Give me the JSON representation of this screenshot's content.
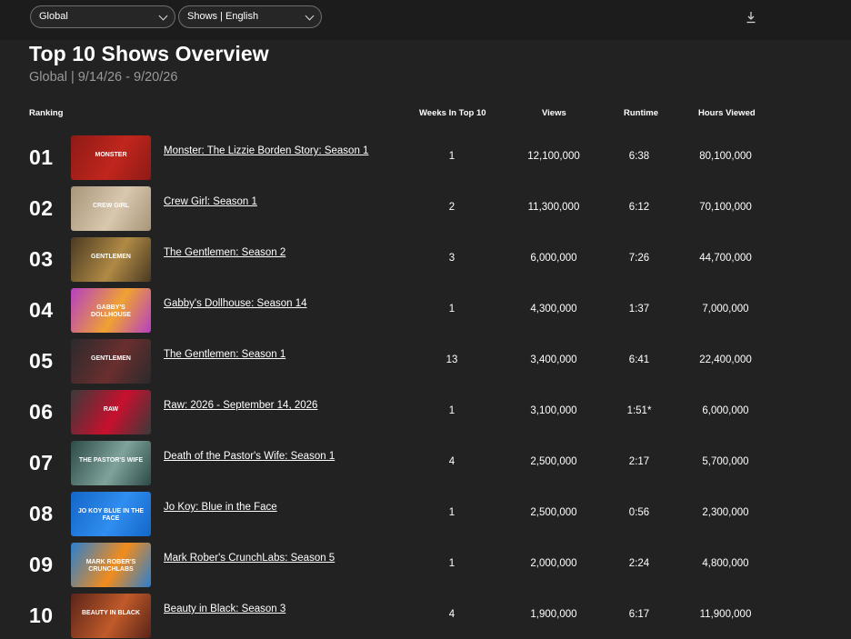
{
  "filters": {
    "region": "Global",
    "category": "Shows | English"
  },
  "header": {
    "title": "Top 10 Shows Overview",
    "subtitle": "Global | 9/14/26 - 9/20/26"
  },
  "columns": {
    "ranking": "Ranking",
    "weeks": "Weeks In Top 10",
    "views": "Views",
    "runtime": "Runtime",
    "hours": "Hours Viewed"
  },
  "rows": [
    {
      "rank": "01",
      "title": "Monster: The Lizzie Borden Story: Season 1",
      "weeks": "1",
      "views": "12,100,000",
      "runtime": "6:38",
      "hours": "80,100,000",
      "thumb_text": "MONSTER",
      "thumb_bg": "#8e1a16",
      "thumb_accent": "#c0261d"
    },
    {
      "rank": "02",
      "title": "Crew Girl: Season 1",
      "weeks": "2",
      "views": "11,300,000",
      "runtime": "6:12",
      "hours": "70,100,000",
      "thumb_text": "CREW GIRL",
      "thumb_bg": "#a8957a",
      "thumb_accent": "#d8c8ae"
    },
    {
      "rank": "03",
      "title": "The Gentlemen: Season 2",
      "weeks": "3",
      "views": "6,000,000",
      "runtime": "7:26",
      "hours": "44,700,000",
      "thumb_text": "GENTLEMEN",
      "thumb_bg": "#4a3a22",
      "thumb_accent": "#b08a45"
    },
    {
      "rank": "04",
      "title": "Gabby's Dollhouse: Season 14",
      "weeks": "1",
      "views": "4,300,000",
      "runtime": "1:37",
      "hours": "7,000,000",
      "thumb_text": "GABBY'S DOLLHOUSE",
      "thumb_bg": "#b63fc4",
      "thumb_accent": "#f0a232"
    },
    {
      "rank": "05",
      "title": "The Gentlemen: Season 1",
      "weeks": "13",
      "views": "3,400,000",
      "runtime": "6:41",
      "hours": "22,400,000",
      "thumb_text": "GENTLEMEN",
      "thumb_bg": "#2b2a2c",
      "thumb_accent": "#6a2e2e"
    },
    {
      "rank": "06",
      "title": "Raw: 2026 - September 14, 2026",
      "weeks": "1",
      "views": "3,100,000",
      "runtime": "1:51*",
      "hours": "6,000,000",
      "thumb_text": "RAW",
      "thumb_bg": "#3a3a3a",
      "thumb_accent": "#c8102e"
    },
    {
      "rank": "07",
      "title": "Death of the Pastor's Wife: Season 1",
      "weeks": "4",
      "views": "2,500,000",
      "runtime": "2:17",
      "hours": "5,700,000",
      "thumb_text": "THE PASTOR'S WIFE",
      "thumb_bg": "#2d4a48",
      "thumb_accent": "#7fa39b"
    },
    {
      "rank": "08",
      "title": "Jo Koy: Blue in the Face",
      "weeks": "1",
      "views": "2,500,000",
      "runtime": "0:56",
      "hours": "2,300,000",
      "thumb_text": "JO KOY BLUE IN THE FACE",
      "thumb_bg": "#1466c8",
      "thumb_accent": "#2f8ef0"
    },
    {
      "rank": "09",
      "title": "Mark Rober's CrunchLabs: Season 5",
      "weeks": "1",
      "views": "2,000,000",
      "runtime": "2:24",
      "hours": "4,800,000",
      "thumb_text": "MARK ROBER'S CRUNCHLABS",
      "thumb_bg": "#2a7fd0",
      "thumb_accent": "#f28c1c"
    },
    {
      "rank": "10",
      "title": "Beauty in Black: Season 3",
      "weeks": "4",
      "views": "1,900,000",
      "runtime": "6:17",
      "hours": "11,900,000",
      "thumb_text": "BEAUTY IN BLACK",
      "thumb_bg": "#5a2418",
      "thumb_accent": "#c05a2a"
    }
  ]
}
